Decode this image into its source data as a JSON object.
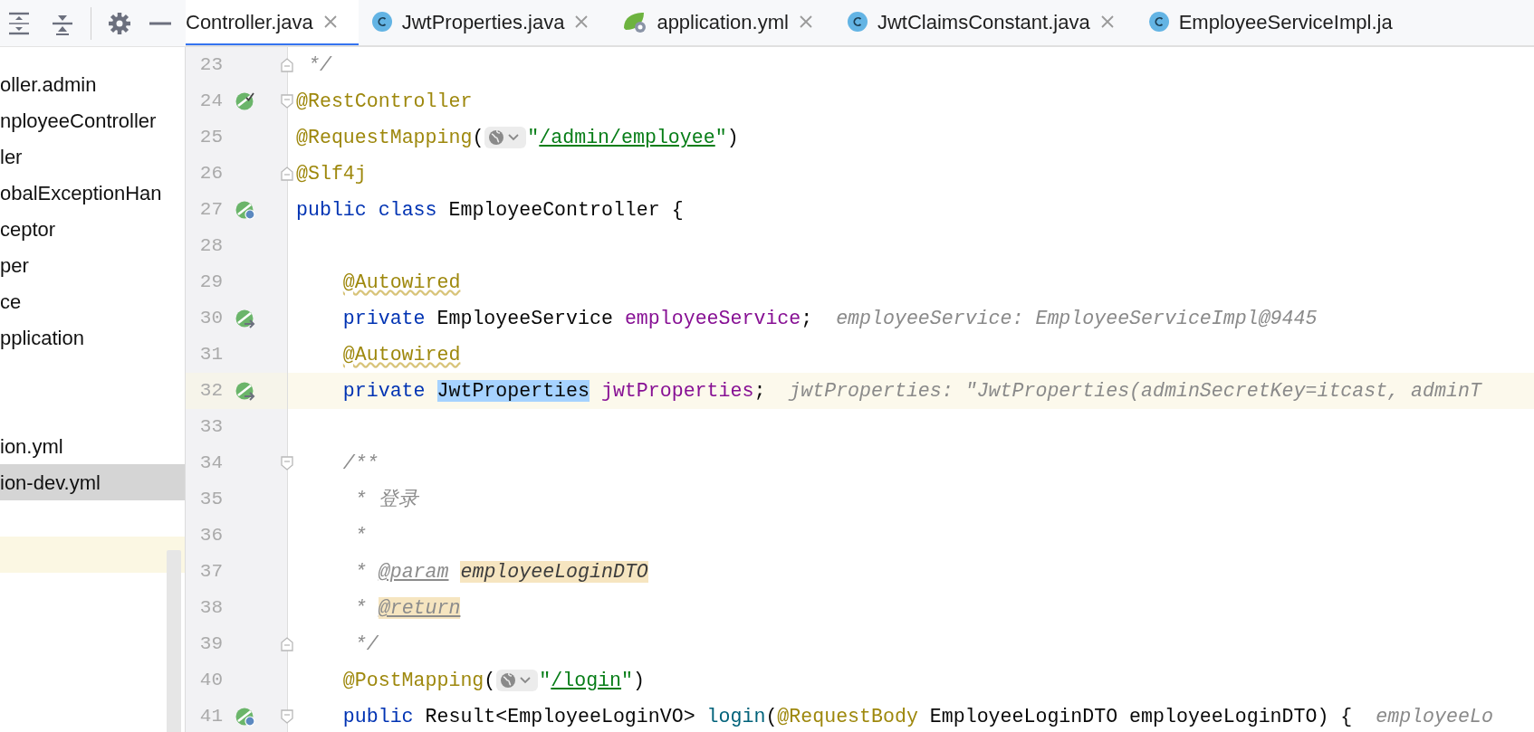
{
  "toolbar": {
    "buttons": [
      {
        "kind": "expand-all"
      },
      {
        "kind": "collapse-all"
      },
      {
        "kind": "settings"
      },
      {
        "kind": "hide"
      }
    ]
  },
  "project_tree": {
    "items": [
      {
        "kind": "file",
        "label": "oller.admin",
        "selected": false
      },
      {
        "kind": "file",
        "label": "nployeeController",
        "selected": false
      },
      {
        "kind": "file",
        "label": "ler",
        "selected": false
      },
      {
        "kind": "file",
        "label": "obalExceptionHan",
        "selected": false
      },
      {
        "kind": "file",
        "label": "ceptor",
        "selected": false
      },
      {
        "kind": "file",
        "label": "per",
        "selected": false
      },
      {
        "kind": "file",
        "label": "ce",
        "selected": false
      },
      {
        "kind": "file",
        "label": "pplication",
        "selected": false
      },
      {
        "kind": "blank",
        "highlighted": false
      },
      {
        "kind": "blank",
        "highlighted": false
      },
      {
        "kind": "file",
        "label": "ion.yml",
        "selected": false
      },
      {
        "kind": "file",
        "label": "ion-dev.yml",
        "selected": true
      },
      {
        "kind": "blank",
        "highlighted": false
      },
      {
        "kind": "blank",
        "highlighted": true
      }
    ]
  },
  "tabs": [
    {
      "kind": "plain",
      "label": "Controller.java",
      "selected": true,
      "closable": true
    },
    {
      "kind": "class",
      "label": "JwtProperties.java",
      "selected": false,
      "closable": true
    },
    {
      "kind": "spring",
      "label": "application.yml",
      "selected": false,
      "closable": true
    },
    {
      "kind": "class",
      "label": "JwtClaimsConstant.java",
      "selected": false,
      "closable": true
    },
    {
      "kind": "class",
      "label": "EmployeeServiceImpl.ja",
      "selected": false,
      "closable": false
    }
  ],
  "editor": {
    "lines": [
      {
        "number": "23",
        "gutter_icons": [
          {
            "kind": "fold-end"
          }
        ],
        "indented": false,
        "current": false,
        "tokens": [
          {
            "kind": "comment",
            "text": " */"
          }
        ]
      },
      {
        "number": "24",
        "gutter_icons": [
          {
            "kind": "bean-check"
          },
          {
            "kind": "fold-start"
          }
        ],
        "indented": false,
        "current": false,
        "tokens": [
          {
            "kind": "annotation",
            "text": "@RestController"
          }
        ]
      },
      {
        "number": "25",
        "indented": false,
        "current": false,
        "tokens": [
          {
            "kind": "annotation",
            "text": "@RequestMapping"
          },
          {
            "kind": "plain",
            "text": "("
          },
          {
            "kind": "url-inlay"
          },
          {
            "kind": "string",
            "text": "\""
          },
          {
            "kind": "url",
            "text": "/admin/employee"
          },
          {
            "kind": "string",
            "text": "\""
          },
          {
            "kind": "plain",
            "text": ")"
          }
        ]
      },
      {
        "number": "26",
        "gutter_icons": [
          {
            "kind": "fold-end"
          }
        ],
        "indented": false,
        "current": false,
        "tokens": [
          {
            "kind": "annotation",
            "text": "@Slf4j"
          }
        ]
      },
      {
        "number": "27",
        "gutter_icons": [
          {
            "kind": "bean-web"
          }
        ],
        "indented": false,
        "current": false,
        "tokens": [
          {
            "kind": "keyword",
            "text": "public class"
          },
          {
            "kind": "plain",
            "text": " EmployeeController {"
          }
        ]
      },
      {
        "number": "28",
        "current": false
      },
      {
        "number": "29",
        "indented": true,
        "current": false,
        "tokens": [
          {
            "kind": "annotation",
            "text": "@Autowired",
            "warning": true
          }
        ]
      },
      {
        "number": "30",
        "gutter_icons": [
          {
            "kind": "bean-inject"
          }
        ],
        "indented": true,
        "current": false,
        "tokens": [
          {
            "kind": "keyword",
            "text": "private"
          },
          {
            "kind": "plain",
            "text": " EmployeeService"
          },
          {
            "kind": "field",
            "text": " employeeService"
          },
          {
            "kind": "plain",
            "text": ";"
          },
          {
            "kind": "hint",
            "text": "  employeeService: EmployeeServiceImpl@9445"
          }
        ]
      },
      {
        "number": "31",
        "indented": true,
        "current": false,
        "tokens": [
          {
            "kind": "annotation",
            "text": "@Autowired",
            "warning": true
          }
        ]
      },
      {
        "number": "32",
        "gutter_icons": [
          {
            "kind": "bean-inject"
          }
        ],
        "indented": true,
        "current": true,
        "tokens": [
          {
            "kind": "keyword",
            "text": "private"
          },
          {
            "kind": "plain",
            "text": " JwtProperties",
            "selected": true
          },
          {
            "kind": "field",
            "text": " jwtProperties"
          },
          {
            "kind": "plain",
            "text": ";"
          },
          {
            "kind": "hint",
            "text": "  jwtProperties: \"JwtProperties(adminSecretKey=itcast, adminT"
          }
        ]
      },
      {
        "number": "33",
        "current": false
      },
      {
        "number": "34",
        "gutter_icons": [
          {
            "kind": "fold-start"
          }
        ],
        "indented": true,
        "current": false,
        "tokens": [
          {
            "kind": "comment",
            "text": "/**"
          }
        ]
      },
      {
        "number": "35",
        "indented": true,
        "current": false,
        "tokens": [
          {
            "kind": "comment",
            "text": " * 登录"
          }
        ]
      },
      {
        "number": "36",
        "indented": true,
        "current": false,
        "tokens": [
          {
            "kind": "comment",
            "text": " *"
          }
        ]
      },
      {
        "number": "37",
        "indented": true,
        "current": false,
        "tokens": [
          {
            "kind": "comment",
            "text": " *"
          },
          {
            "kind": "doc-tag",
            "text": " @param"
          },
          {
            "kind": "param-ref",
            "text": " employeeLoginDTO",
            "highlighted": true
          }
        ]
      },
      {
        "number": "38",
        "indented": true,
        "current": false,
        "tokens": [
          {
            "kind": "comment",
            "text": " *"
          },
          {
            "kind": "doc-tag",
            "text": " @return",
            "highlighted": true
          }
        ]
      },
      {
        "number": "39",
        "gutter_icons": [
          {
            "kind": "fold-end"
          }
        ],
        "indented": true,
        "current": false,
        "tokens": [
          {
            "kind": "comment",
            "text": " */"
          }
        ]
      },
      {
        "number": "40",
        "indented": true,
        "current": false,
        "tokens": [
          {
            "kind": "annotation",
            "text": "@PostMapping"
          },
          {
            "kind": "plain",
            "text": "("
          },
          {
            "kind": "url-inlay"
          },
          {
            "kind": "string",
            "text": "\""
          },
          {
            "kind": "url",
            "text": "/login"
          },
          {
            "kind": "string",
            "text": "\""
          },
          {
            "kind": "plain",
            "text": ")"
          }
        ]
      },
      {
        "number": "41",
        "gutter_icons": [
          {
            "kind": "bean-web"
          },
          {
            "kind": "fold-start"
          }
        ],
        "indented": true,
        "current": false,
        "tokens": [
          {
            "kind": "keyword",
            "text": "public"
          },
          {
            "kind": "plain",
            "text": " Result<EmployeeLoginVO>"
          },
          {
            "kind": "method",
            "text": " login"
          },
          {
            "kind": "plain",
            "text": "("
          },
          {
            "kind": "annotation",
            "text": "@RequestBody"
          },
          {
            "kind": "plain",
            "text": " EmployeeLoginDTO employeeLoginDTO) {"
          },
          {
            "kind": "hint",
            "text": "  employeeLo"
          }
        ]
      }
    ]
  }
}
